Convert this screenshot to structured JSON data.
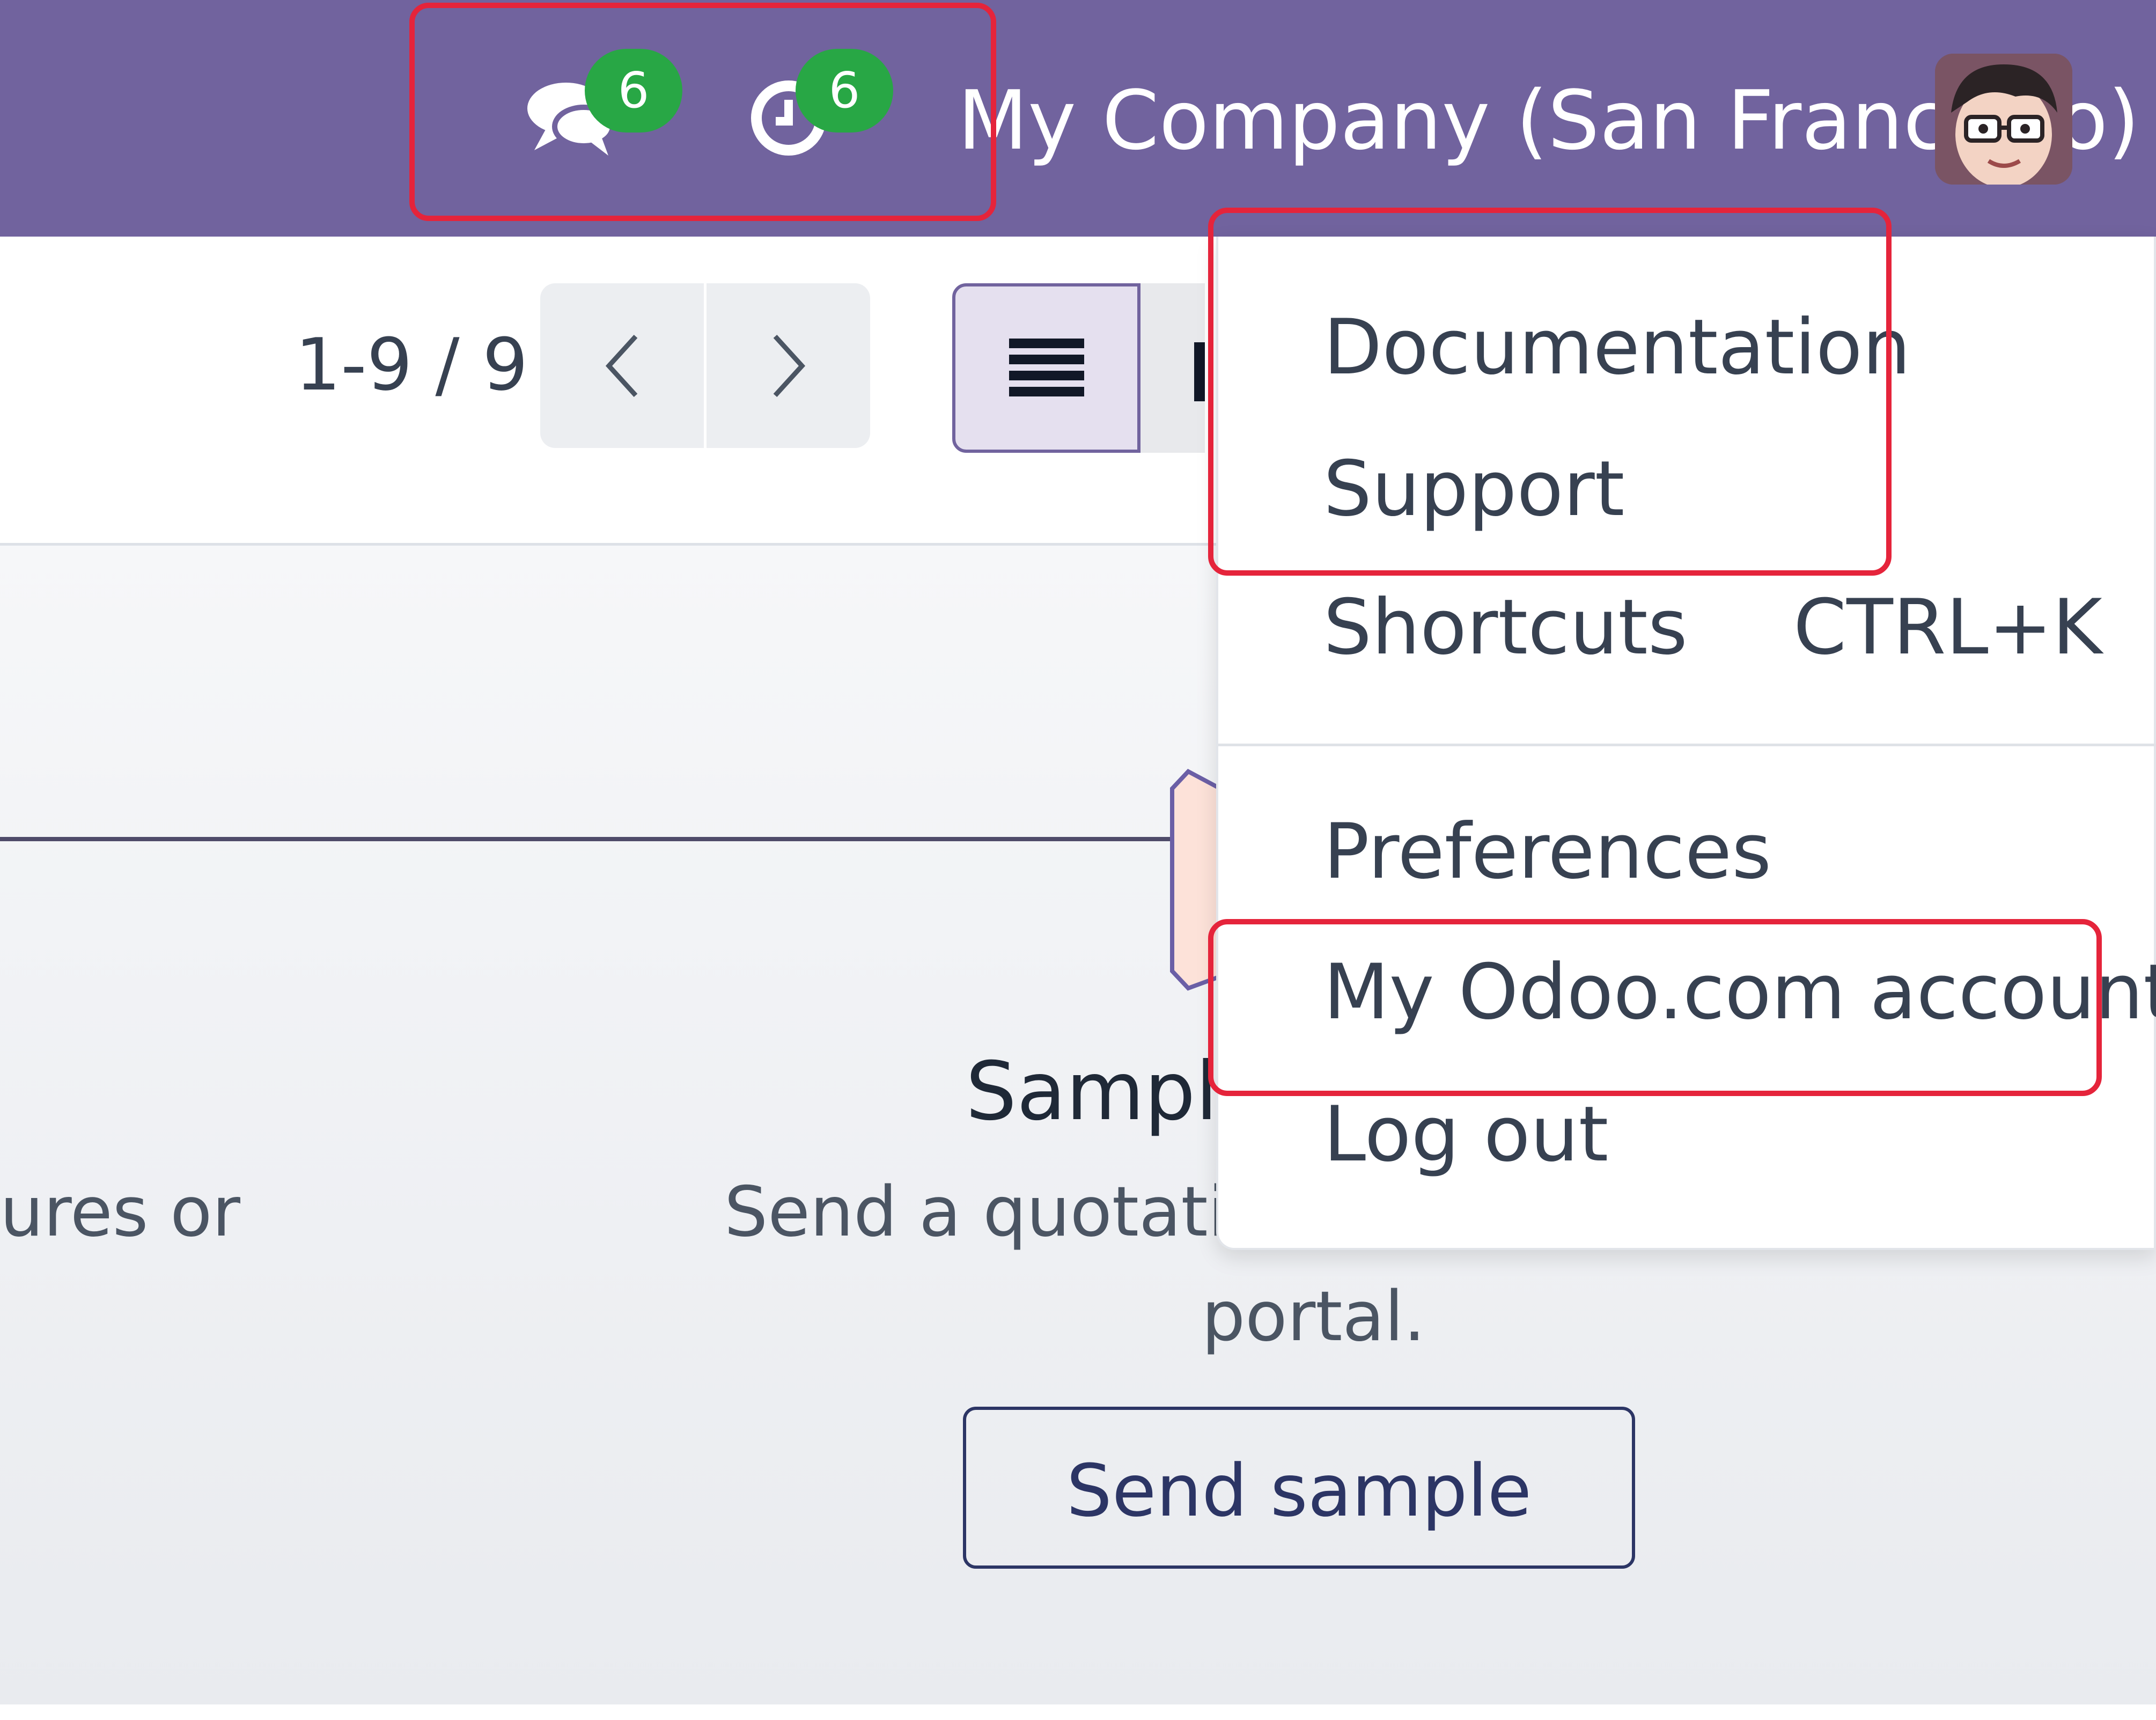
{
  "navbar": {
    "company": "My Company (San Francisco)",
    "messages_icon": "chat-icon",
    "messages_count": "6",
    "activities_icon": "clock-icon",
    "activities_count": "6",
    "avatar_icon": "user-avatar",
    "background": "#71639e"
  },
  "control_panel": {
    "pager_value": "1-9 / 9",
    "prev_icon": "chevron-left-icon",
    "next_icon": "chevron-right-icon",
    "list_view_icon": "list-icon",
    "kanban_view_icon": "kanban-icon"
  },
  "helper": {
    "left_text": "ures or",
    "title": "Sample",
    "description": "Send a quotation",
    "description_tail": "portal.",
    "button": "Send sample"
  },
  "user_menu": {
    "items": [
      {
        "label": "Documentation"
      },
      {
        "label": "Support"
      },
      {
        "label": "Shortcuts",
        "shortcut": "CTRL+K"
      },
      {
        "label": "Preferences"
      },
      {
        "label": "My Odoo.com account"
      },
      {
        "label": "Log out"
      }
    ]
  },
  "colors": {
    "accent": "#71639e",
    "badge": "#28a745",
    "highlight": "#e5243b",
    "primary_text": "#2c3565"
  }
}
